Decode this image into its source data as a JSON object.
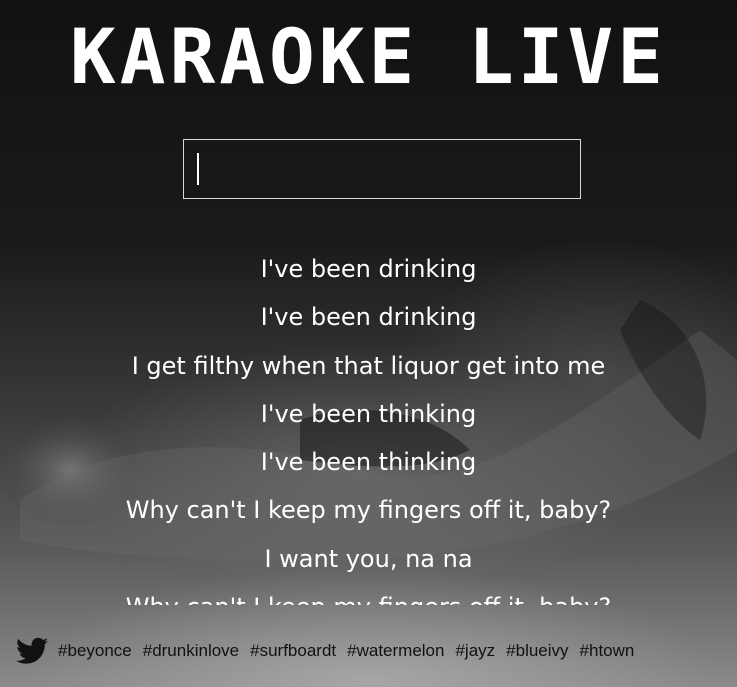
{
  "header": {
    "title": "KARAOKE LIVE"
  },
  "search": {
    "value": "",
    "placeholder": ""
  },
  "lyrics": {
    "lines": [
      "I've been drinking",
      "I've been drinking",
      "I get filthy when that liquor get into me",
      "I've been thinking",
      "I've been thinking",
      "Why can't I keep my fingers off it, baby?",
      "I want you, na na",
      "Why can't I keep my fingers off it, baby?"
    ]
  },
  "footer": {
    "icon": "twitter-bird-icon",
    "hashtags": [
      "#beyonce",
      "#drunkinlove",
      "#surfboardt",
      "#watermelon",
      "#jayz",
      "#blueivy",
      "#htown"
    ]
  },
  "colors": {
    "text": "#ffffff",
    "hashtag": "#111111",
    "input_border": "#d8d8d8"
  }
}
